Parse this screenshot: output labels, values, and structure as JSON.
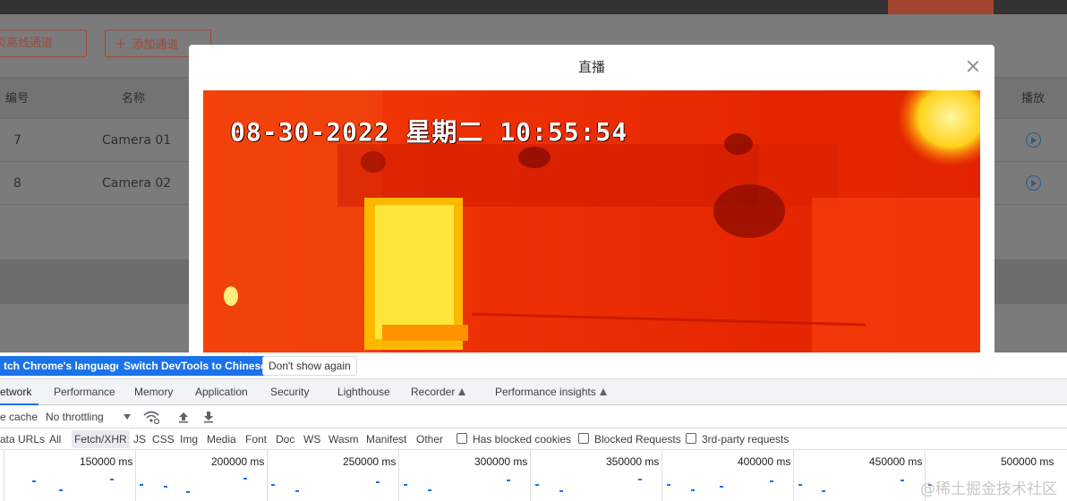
{
  "page": {
    "offline_button": "本页离线通道",
    "add_button": "添加通道",
    "table": {
      "headers": {
        "id": "编号",
        "name": "名称",
        "play": "播放"
      },
      "rows": [
        {
          "id": "7",
          "name": "Camera 01"
        },
        {
          "id": "8",
          "name": "Camera 02"
        }
      ]
    }
  },
  "modal": {
    "title": "直播",
    "video_overlay": "08-30-2022 星期二 10:55:54"
  },
  "devtools": {
    "infobar": {
      "switch_chrome_language": "tch Chrome's language",
      "switch_devtools_chinese": "Switch DevTools to Chinese",
      "dont_show_again": "Don't show again"
    },
    "tabs": [
      "etwork",
      "Performance",
      "Memory",
      "Application",
      "Security",
      "Lighthouse",
      "Recorder",
      "Performance insights"
    ],
    "toolbar": {
      "cache": "e cache",
      "throttling": "No throttling"
    },
    "filters": [
      "ata URLs",
      "All",
      "Fetch/XHR",
      "JS",
      "CSS",
      "Img",
      "Media",
      "Font",
      "Doc",
      "WS",
      "Wasm",
      "Manifest",
      "Other"
    ],
    "checkboxes": [
      "Has blocked cookies",
      "Blocked Requests",
      "3rd-party requests"
    ],
    "timeline_ticks": [
      "150000 ms",
      "200000 ms",
      "250000 ms",
      "300000 ms",
      "350000 ms",
      "400000 ms",
      "450000 ms",
      "500000 ms"
    ]
  },
  "watermark": "@稀土掘金技术社区",
  "colors": {
    "accent": "#1a73e8",
    "brand_button": "#a04a38",
    "thermal_red": "#ef2a00"
  }
}
